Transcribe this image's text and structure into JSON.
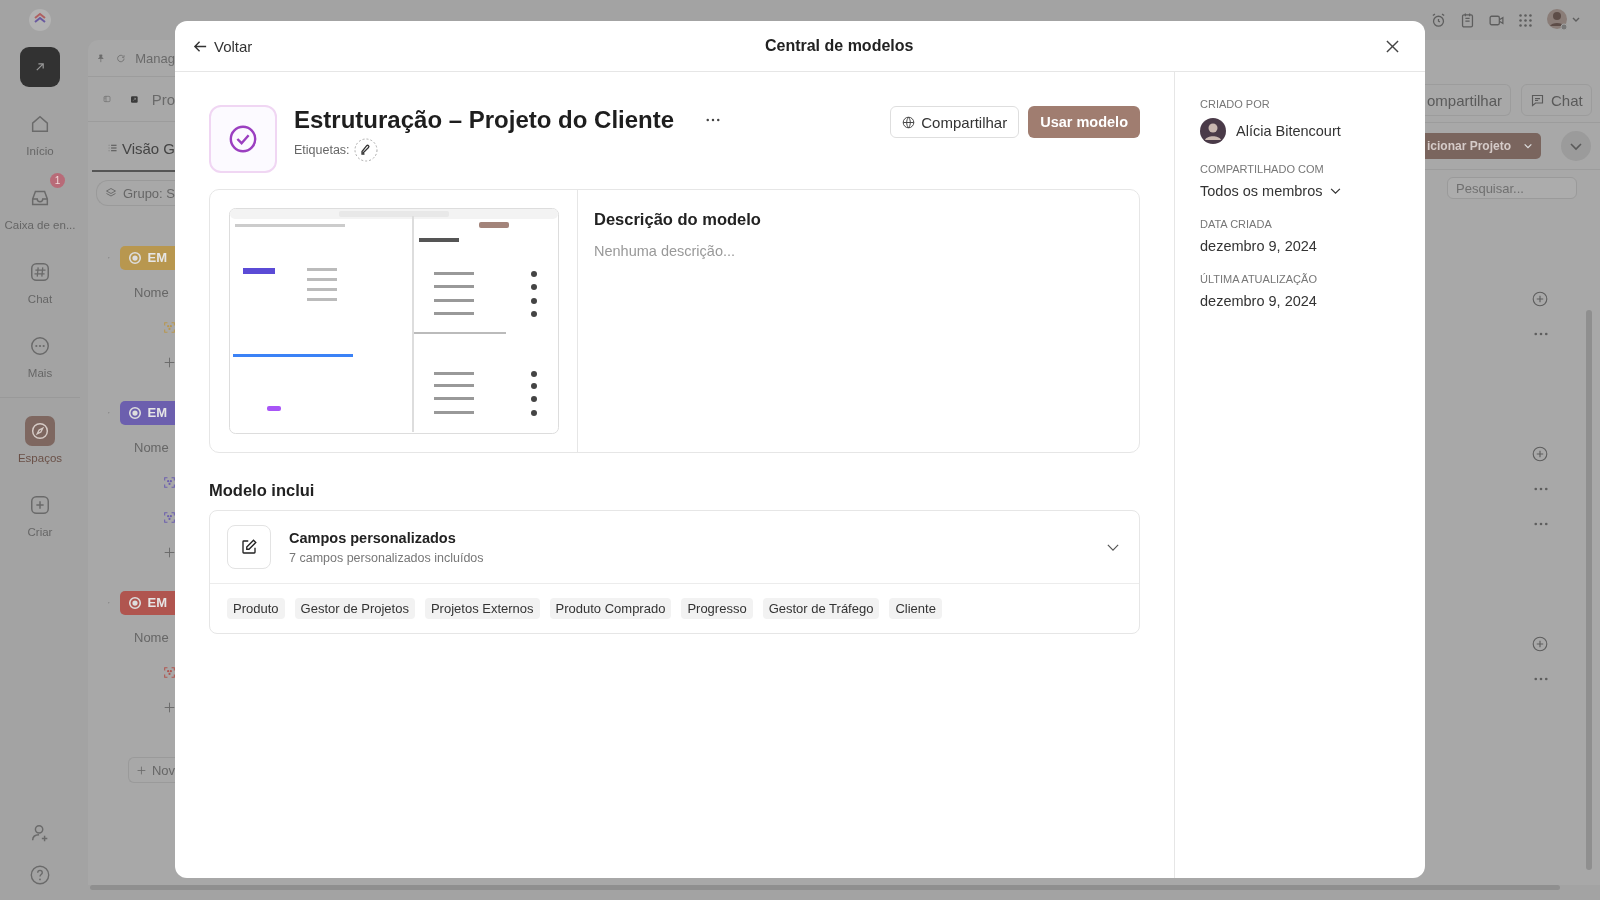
{
  "background": {
    "sidebar": {
      "items": [
        {
          "label": "Início",
          "selected": false
        },
        {
          "label": "Caixa de en...",
          "badge": "1",
          "selected": false
        },
        {
          "label": "Chat",
          "selected": false
        },
        {
          "label": "Mais",
          "selected": false
        },
        {
          "label": "Espaços",
          "selected": true
        },
        {
          "label": "Criar",
          "selected": false
        }
      ]
    },
    "toolbar": {
      "breadcrumb": "Manag",
      "project": "Pro",
      "view_tab": "Visão G",
      "group_button": "Grupo: S",
      "share_button": "ompartilhar",
      "chat_button": "Chat",
      "add_button": "icionar Projeto",
      "search": {
        "placeholder": "Pesquisar..."
      }
    },
    "groups": [
      {
        "label": "EM",
        "color": "#b8974f",
        "column": "Nome",
        "tasks": [
          {
            "kind": "task"
          }
        ]
      },
      {
        "label": "EM",
        "color": "#6c5fae",
        "column": "Nome",
        "tasks": [
          {
            "kind": "task"
          },
          {
            "kind": "task"
          }
        ]
      },
      {
        "label": "EM",
        "color": "#b0554f",
        "column": "Nome",
        "tasks": [
          {
            "kind": "task"
          }
        ]
      }
    ],
    "new_button": "Nov"
  },
  "modal": {
    "back": "Voltar",
    "title": "Central de modelos",
    "template": {
      "name": "Estruturação – Projeto do Cliente",
      "tags_label": "Etiquetas:",
      "share_button": "Compartilhar",
      "use_button": "Usar modelo",
      "description_title": "Descrição do modelo",
      "description_placeholder": "Nenhuma descrição...",
      "includes_title": "Modelo inclui",
      "includes": [
        {
          "title": "Campos personalizados",
          "subtitle": "7 campos personalizados incluídos",
          "expanded": true,
          "fields": [
            "Produto",
            "Gestor de Projetos",
            "Projetos Externos",
            "Produto Comprado",
            "Progresso",
            "Gestor de Tráfego",
            "Cliente"
          ]
        }
      ]
    },
    "details": [
      {
        "label": "CRIADO POR",
        "value": "Alícia Bitencourt",
        "kind": "user"
      },
      {
        "label": "COMPARTILHADO COM",
        "value": "Todos os membros",
        "kind": "dropdown"
      },
      {
        "label": "DATA CRIADA",
        "value": "dezembro 9, 2024",
        "kind": "text"
      },
      {
        "label": "ÚLTIMA ATUALIZAÇÃO",
        "value": "dezembro 9, 2024",
        "kind": "text"
      }
    ]
  }
}
